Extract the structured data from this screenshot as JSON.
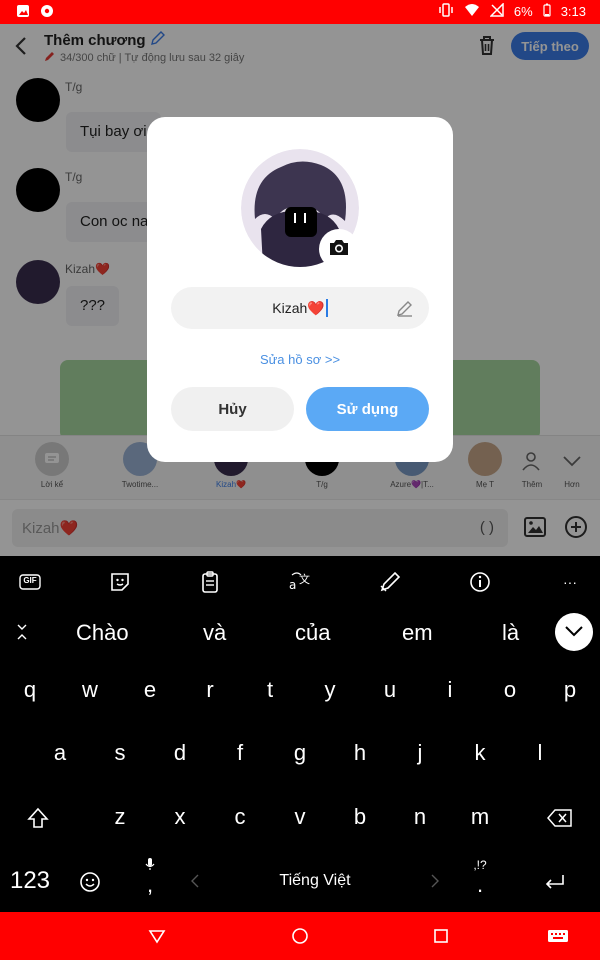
{
  "status_bar": {
    "battery": "6%",
    "time": "3:13"
  },
  "header": {
    "title": "Thêm chương",
    "subtitle": "34/300 chữ | Tự động lưu sau 32 giây",
    "next_label": "Tiếp theo"
  },
  "chat": {
    "messages": [
      {
        "name": "T/g",
        "text": "Tụi bay ơi"
      },
      {
        "name": "T/g",
        "text": "Con oc na"
      },
      {
        "name": "Kizah❤️",
        "text": "???"
      }
    ]
  },
  "characters": [
    {
      "label": "Lời kể"
    },
    {
      "label": "Twotime..."
    },
    {
      "label": "Kizah❤️"
    },
    {
      "label": "T/g"
    },
    {
      "label": "Azure💜|T..."
    },
    {
      "label": "Mẹ T"
    },
    {
      "label": "Thêm"
    },
    {
      "label": "Hơn"
    }
  ],
  "composer": {
    "placeholder": "Kizah❤️",
    "paren": "( )"
  },
  "modal": {
    "name_value": "Kizah❤️",
    "edit_profile_link": "Sửa hồ sơ >>",
    "cancel_label": "Hủy",
    "use_label": "Sử dụng"
  },
  "keyboard": {
    "toolbar_icons": [
      "gif-icon",
      "sticker-icon",
      "clipboard-icon",
      "translate-icon",
      "handwriting-icon",
      "info-icon",
      "more-icon"
    ],
    "gif_label": "GIF",
    "more_label": "···",
    "suggestions": [
      "Chào",
      "và",
      "của",
      "em",
      "là"
    ],
    "row1": [
      "q",
      "w",
      "e",
      "r",
      "t",
      "y",
      "u",
      "i",
      "o",
      "p"
    ],
    "row2": [
      "a",
      "s",
      "d",
      "f",
      "g",
      "h",
      "j",
      "k",
      "l"
    ],
    "row3": [
      "z",
      "x",
      "c",
      "v",
      "b",
      "n",
      "m"
    ],
    "num_label": "123",
    "comma": ",",
    "space_label": "Tiếng Việt",
    "punct_top": ",!?",
    "punct_bottom": "."
  },
  "colors": {
    "status_bar": "#ff0000",
    "accent": "#3b7de9",
    "use_button": "#5ba9f5",
    "link": "#4a90e2",
    "keyboard_bg": "#000000"
  }
}
